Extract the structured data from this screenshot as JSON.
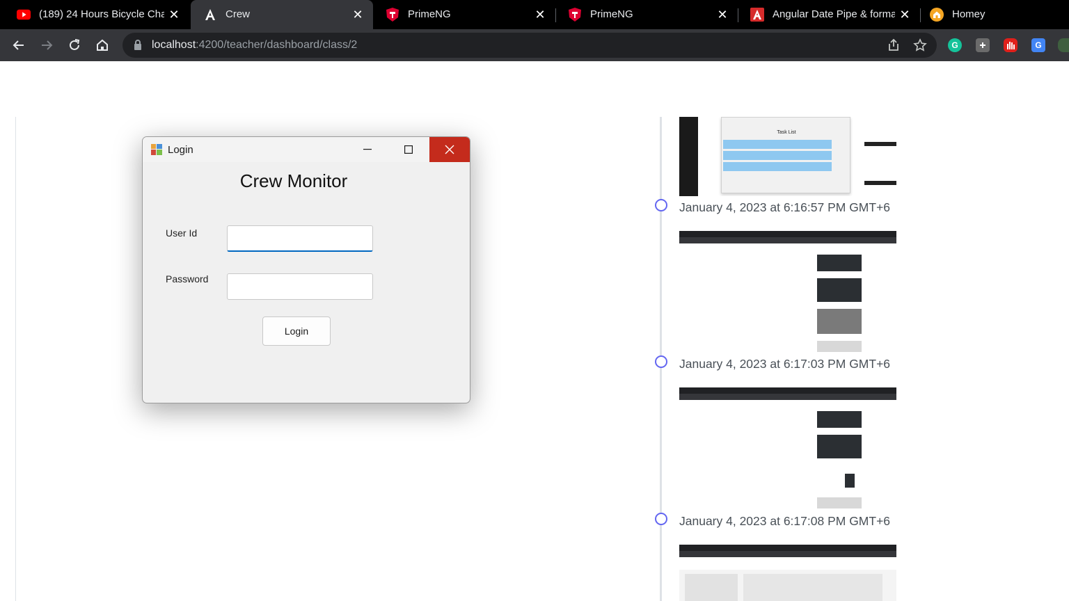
{
  "browser": {
    "tabs": [
      {
        "title": "(189) 24 Hours Bicycle Chall",
        "icon": "youtube-icon",
        "active": false
      },
      {
        "title": "Crew",
        "icon": "angular-icon",
        "active": true
      },
      {
        "title": "PrimeNG",
        "icon": "primeng-icon",
        "active": false
      },
      {
        "title": "PrimeNG",
        "icon": "primeng-icon",
        "active": false
      },
      {
        "title": "Angular Date Pipe & forma",
        "icon": "pdf-icon",
        "active": false
      },
      {
        "title": "Homey",
        "icon": "homey-icon",
        "active": false
      }
    ],
    "address": {
      "host": "localhost",
      "path": ":4200/teacher/dashboard/class/2"
    },
    "extensions": [
      "grammarly-icon",
      "extension-icon",
      "adblock-icon",
      "translate-icon",
      "extension-icon"
    ]
  },
  "login_window": {
    "title": "Login",
    "heading": "Crew Monitor",
    "user_id_label": "User Id",
    "user_id_value": "",
    "password_label": "Password",
    "password_value": "",
    "login_button": "Login"
  },
  "timeline": {
    "entries": [
      {
        "date": "January 4, 2023 at 6:16:57 PM GMT+6"
      },
      {
        "date": "January 4, 2023 at 6:17:03 PM GMT+6"
      },
      {
        "date": "January 4, 2023 at 6:17:08 PM GMT+6"
      }
    ],
    "first_thumb_heading": "Task List"
  },
  "colors": {
    "accent": "#6366f1",
    "close_red": "#c42b1c",
    "focus_blue": "#0067c0"
  }
}
